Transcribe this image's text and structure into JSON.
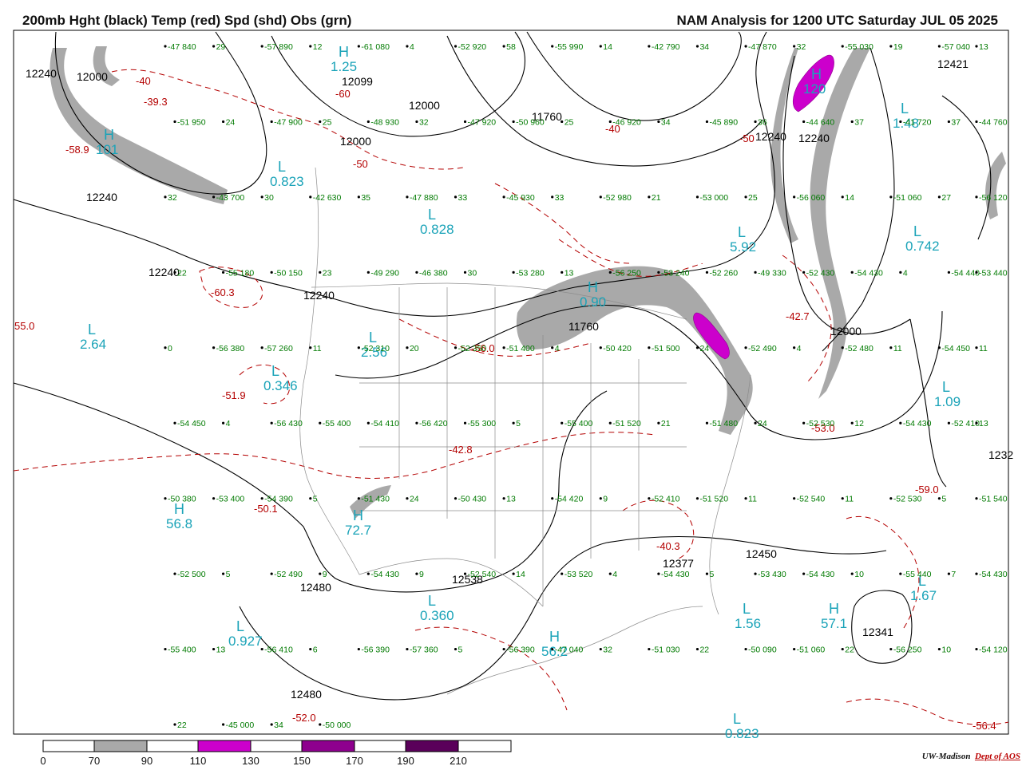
{
  "header": {
    "title_left": "200mb Hght (black) Temp (red) Spd (shd) Obs (grn)",
    "title_right": "NAM Analysis for 1200 UTC Saturday  JUL 05 2025"
  },
  "colors": {
    "height": "#000000",
    "temp": "#b40000",
    "obs": "#007a00",
    "pressure_centers": "#1aa3b8",
    "speed_70_90": "#a9a9a9",
    "speed_110_130": "#cc00cc",
    "speed_150_170": "#8e008e",
    "speed_190_210": "#5a005a"
  },
  "legend": {
    "ticks": [
      "0",
      "70",
      "90",
      "110",
      "130",
      "150",
      "170",
      "190",
      "210"
    ]
  },
  "credit": {
    "org": "UW-Madison",
    "dept": "Dept of AOS"
  },
  "height_labels": [
    "12240",
    "12000",
    "12099",
    "12000",
    "11760",
    "12000",
    "12421",
    "12240",
    "12240",
    "11760",
    "12240",
    "12000",
    "12240",
    "12240",
    "12450",
    "12377",
    "12538",
    "12480",
    "12341",
    "12480",
    "1232"
  ],
  "temp_labels": [
    "-40",
    "-39.3",
    "-58.9",
    "-60",
    "-40",
    "-50",
    "-60.3",
    "-56.0",
    "-51.9",
    "-42.8",
    "-50.1",
    "-50",
    "-42.7",
    "-53.0",
    "-59.0",
    "-40.3",
    "-52.0",
    "-56.4",
    "55.0"
  ],
  "center_values": [
    "101",
    "0.823",
    "1.25",
    "0.828",
    "2.64",
    "2.56",
    "0.346",
    "56.8",
    "72.7",
    "0.360",
    "0.927",
    "56.2",
    "120",
    "1.48",
    "0.742",
    "5.92",
    "1.09",
    "1.67",
    "57.1",
    "1.56",
    "0.823",
    "0.90"
  ],
  "obs_labels": [
    "-47 840",
    "29",
    "-57 890",
    "12",
    "-61 080",
    "4",
    "-52 920",
    "58",
    "-55 990",
    "14",
    "-42 790",
    "34",
    "-47 870",
    "32",
    "-55 030",
    "19",
    "-57 040",
    "13",
    "-51 950",
    "24",
    "-47 900",
    "25",
    "-48 930",
    "32",
    "-47 920",
    "-50 960",
    "25",
    "-46 920",
    "34",
    "-45 890",
    "36",
    "-44 640",
    "37",
    "-41 720",
    "37",
    "-44 760",
    "32",
    "-43 700",
    "30",
    "-42 630",
    "35",
    "-47 880",
    "33",
    "-45 930",
    "33",
    "-52 980",
    "21",
    "-53 000",
    "25",
    "-56 060",
    "14",
    "-51 060",
    "27",
    "-56 120",
    "22",
    "-55 180",
    "-50 150",
    "23",
    "-49 290",
    "-46 380",
    "30",
    "-53 280",
    "13",
    "-56 250",
    "-53 240",
    "-52 260",
    "-49 330",
    "-52 430",
    "-54 430",
    "4",
    "-54 440",
    "-53 440",
    "0",
    "-56 380",
    "-57 260",
    "11",
    "-52 310",
    "20",
    "-52 350",
    "-51 400",
    "4",
    "-50 420",
    "-51 500",
    "24",
    "-52 490",
    "4",
    "-52 480",
    "11",
    "-54 450",
    "11",
    "-54 450",
    "4",
    "-56 430",
    "-55 400",
    "-54 410",
    "-56 420",
    "-55 300",
    "5",
    "-55 400",
    "-51 520",
    "21",
    "-51 480",
    "24",
    "-52 530",
    "12",
    "-54 430",
    "-52 410",
    "13",
    "-50 380",
    "-53 400",
    "-54 390",
    "5",
    "-51 430",
    "24",
    "-50 430",
    "13",
    "-54 420",
    "9",
    "-52 410",
    "-51 520",
    "11",
    "-52 540",
    "11",
    "-52 530",
    "5",
    "-51 540",
    "-52 500",
    "5",
    "-52 490",
    "9",
    "-54 430",
    "9",
    "-52 540",
    "14",
    "-53 520",
    "4",
    "-54 430",
    "5",
    "-53 430",
    "-54 430",
    "10",
    "-55 440",
    "7",
    "-54 430",
    "-55 400",
    "13",
    "-56 410",
    "6",
    "-56 390",
    "-57 360",
    "5",
    "-56 390",
    "-47 040",
    "32",
    "-51 030",
    "22",
    "-50 090",
    "-51 060",
    "22",
    "-56 250",
    "10",
    "-54 120",
    "22",
    "-45 000",
    "34",
    "-50 000"
  ]
}
